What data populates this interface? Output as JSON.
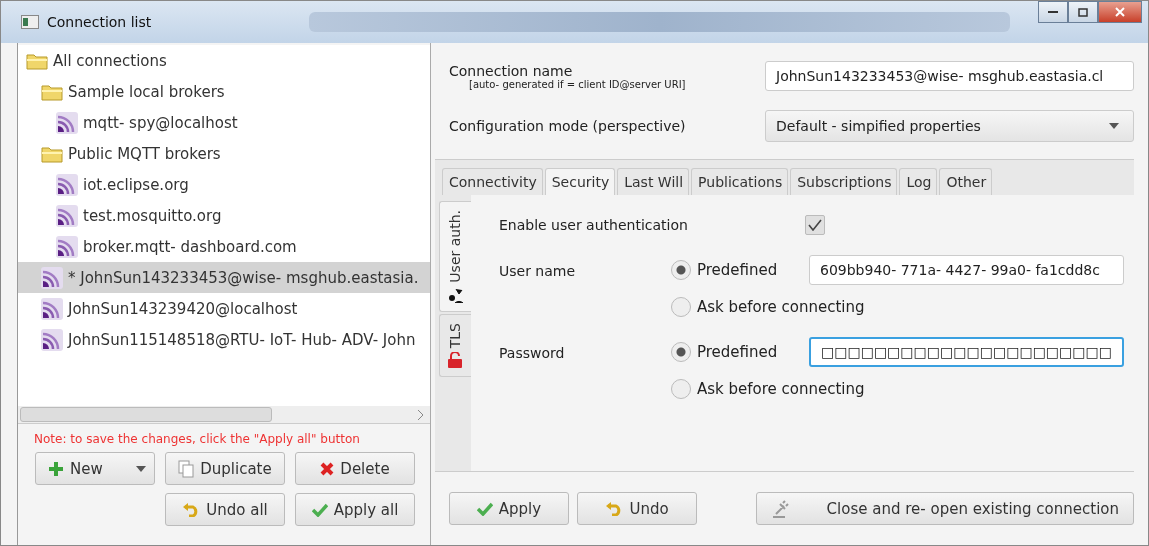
{
  "window": {
    "title": "Connection list"
  },
  "tree": [
    {
      "label": "All connections",
      "kind": "folder",
      "selected": false,
      "children": [
        {
          "label": "Sample local brokers",
          "kind": "folder",
          "selected": false,
          "children": [
            {
              "label": "mqtt- spy@localhost",
              "kind": "connection",
              "selected": false
            }
          ]
        },
        {
          "label": "Public MQTT brokers",
          "kind": "folder",
          "selected": false,
          "children": [
            {
              "label": "iot.eclipse.org",
              "kind": "connection",
              "selected": false
            },
            {
              "label": "test.mosquitto.org",
              "kind": "connection",
              "selected": false
            },
            {
              "label": "broker.mqtt- dashboard.com",
              "kind": "connection",
              "selected": false
            }
          ]
        },
        {
          "label": "* JohnSun143233453@wise- msghub.eastasia.",
          "kind": "connection",
          "selected": true
        },
        {
          "label": "JohnSun143239420@localhost",
          "kind": "connection",
          "selected": false
        },
        {
          "label": "JohnSun115148518@RTU- IoT- Hub- ADV- John",
          "kind": "connection",
          "selected": false
        }
      ]
    }
  ],
  "note": "Note: to save the changes, click the \"Apply all\" button",
  "list_buttons": [
    {
      "label": "New",
      "kind": "new"
    },
    {
      "label": "Duplicate",
      "kind": "duplicate"
    },
    {
      "label": "Delete",
      "kind": "delete"
    },
    {
      "label": "Undo all",
      "kind": "undo"
    },
    {
      "label": "Apply all",
      "kind": "apply"
    }
  ],
  "connection_name": {
    "label": "Connection name",
    "hint": "[auto- generated if =  client ID@server URI]",
    "value": "JohnSun143233453@wise- msghub.eastasia.cl"
  },
  "configuration_mode": {
    "label": "Configuration mode (perspective)",
    "value": "Default -  simpified properties"
  },
  "tabs": [
    {
      "label": "Connectivity",
      "selected": false
    },
    {
      "label": "Security",
      "selected": true
    },
    {
      "label": "Last Will",
      "selected": false
    },
    {
      "label": "Publications",
      "selected": false
    },
    {
      "label": "Subscriptions",
      "selected": false
    },
    {
      "label": "Log",
      "selected": false
    },
    {
      "label": "Other",
      "selected": false
    }
  ],
  "side_tabs": [
    {
      "label": "User auth.",
      "kind": "user",
      "selected": true
    },
    {
      "label": "TLS",
      "kind": "lock",
      "selected": false
    }
  ],
  "security": {
    "enable_label": "Enable user authentication",
    "enabled": true,
    "fields": [
      {
        "label": "User name",
        "options": [
          {
            "label": "Predefined",
            "selected": true
          },
          {
            "label": "Ask before connecting",
            "selected": false
          }
        ],
        "value": "609bb940- 771a- 4427- 99a0- fa1cdd8c",
        "focused": false
      },
      {
        "label": "Password",
        "options": [
          {
            "label": "Predefined",
            "selected": true
          },
          {
            "label": "Ask before connecting",
            "selected": false
          }
        ],
        "value": "□□□□□□□□□□□□□□□□□□□□□□",
        "focused": true
      }
    ]
  },
  "bottom_buttons": [
    {
      "label": "Apply",
      "kind": "apply"
    },
    {
      "label": "Undo",
      "kind": "undo"
    },
    {
      "label": "Close and re- open existing connection",
      "kind": "reconnect"
    }
  ]
}
